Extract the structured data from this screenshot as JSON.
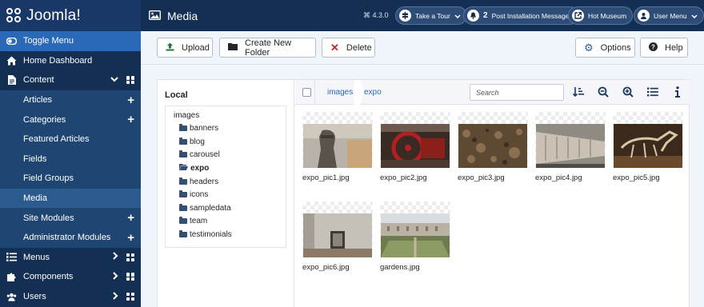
{
  "app": {
    "logo_text": "Joomla!",
    "version": "4.3.0"
  },
  "sidebar": {
    "items": [
      {
        "label": "Toggle Menu"
      },
      {
        "label": "Home Dashboard"
      },
      {
        "label": "Content"
      },
      {
        "label": "Articles"
      },
      {
        "label": "Categories"
      },
      {
        "label": "Featured Articles"
      },
      {
        "label": "Fields"
      },
      {
        "label": "Field Groups"
      },
      {
        "label": "Media"
      },
      {
        "label": "Site Modules"
      },
      {
        "label": "Administrator Modules"
      },
      {
        "label": "Menus"
      },
      {
        "label": "Components"
      },
      {
        "label": "Users"
      }
    ]
  },
  "header": {
    "title": "Media",
    "take_tour": "Take a Tour",
    "post_install_count": "2",
    "post_install": "Post Installation Messages",
    "site_name": "Hot Museum",
    "user_menu": "User Menu"
  },
  "toolbar": {
    "upload": "Upload",
    "new_folder": "Create New Folder",
    "delete": "Delete",
    "options": "Options",
    "help": "Help"
  },
  "tree": {
    "title": "Local",
    "root": "images",
    "folders": [
      "banners",
      "blog",
      "carousel",
      "expo",
      "headers",
      "icons",
      "sampledata",
      "team",
      "testimonials"
    ],
    "active": "expo"
  },
  "browser": {
    "breadcrumb": [
      "images",
      "expo"
    ],
    "search_placeholder": "Search",
    "files": [
      {
        "name": "expo_pic1.jpg"
      },
      {
        "name": "expo_pic2.jpg"
      },
      {
        "name": "expo_pic3.jpg"
      },
      {
        "name": "expo_pic4.jpg"
      },
      {
        "name": "expo_pic5.jpg"
      },
      {
        "name": "expo_pic6.jpg"
      },
      {
        "name": "gardens.jpg"
      }
    ]
  },
  "colors": {
    "sidebar": "#132f53",
    "active": "#2a69b8",
    "link": "#2a69b8"
  }
}
